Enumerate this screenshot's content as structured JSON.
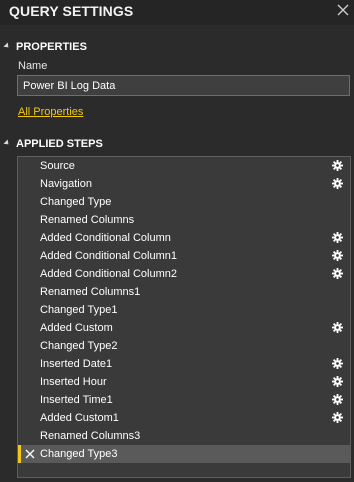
{
  "header": {
    "title": "QUERY SETTINGS"
  },
  "properties": {
    "section_label": "PROPERTIES",
    "name_label": "Name",
    "name_value": "Power BI Log Data",
    "all_properties_link": "All Properties"
  },
  "applied_steps": {
    "section_label": "APPLIED STEPS",
    "steps": [
      {
        "label": "Source",
        "has_gear": true
      },
      {
        "label": "Navigation",
        "has_gear": true
      },
      {
        "label": "Changed Type",
        "has_gear": false
      },
      {
        "label": "Renamed Columns",
        "has_gear": false
      },
      {
        "label": "Added Conditional Column",
        "has_gear": true
      },
      {
        "label": "Added Conditional Column1",
        "has_gear": true
      },
      {
        "label": "Added Conditional Column2",
        "has_gear": true
      },
      {
        "label": "Renamed Columns1",
        "has_gear": false
      },
      {
        "label": "Changed Type1",
        "has_gear": false
      },
      {
        "label": "Added Custom",
        "has_gear": true
      },
      {
        "label": "Changed Type2",
        "has_gear": false
      },
      {
        "label": "Inserted Date1",
        "has_gear": true
      },
      {
        "label": "Inserted Hour",
        "has_gear": true
      },
      {
        "label": "Inserted Time1",
        "has_gear": true
      },
      {
        "label": "Added Custom1",
        "has_gear": true
      },
      {
        "label": "Renamed Columns3",
        "has_gear": false
      },
      {
        "label": "Changed Type3",
        "has_gear": false,
        "selected": true
      }
    ]
  },
  "colors": {
    "accent": "#f2c811",
    "panel_bg": "#2b2b2b",
    "steps_bg": "#3a3a3a"
  },
  "icons": {
    "close": "close-icon",
    "section_toggle": "collapse-triangle-icon",
    "step_settings": "gear-icon",
    "step_delete": "delete-x-icon"
  }
}
